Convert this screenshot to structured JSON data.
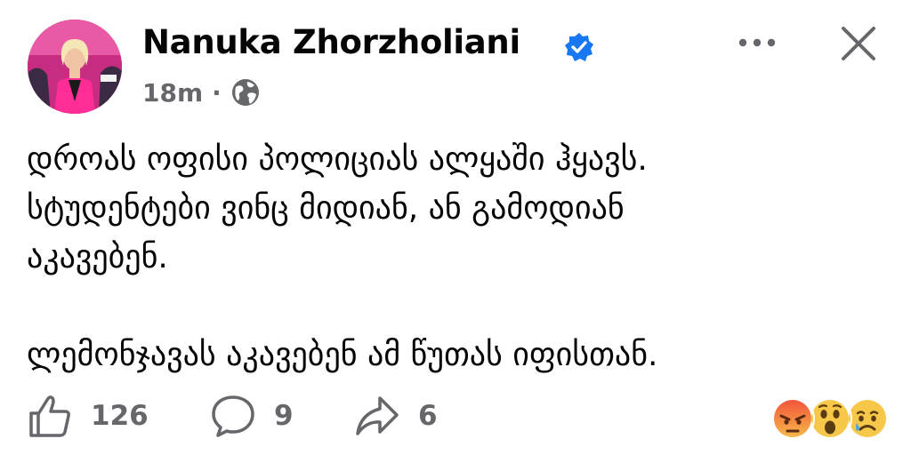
{
  "author": {
    "name": "Nanuka Zhorzholiani",
    "verified": true,
    "avatar_icon": "avatar-illustration"
  },
  "meta": {
    "time": "18m",
    "separator": "·",
    "privacy_icon": "globe-icon"
  },
  "header_actions": {
    "more_icon": "more-horizontal-icon",
    "close_icon": "close-icon"
  },
  "post": {
    "paragraph1_lines": [
      "დროას ოფისი პოლიციას ალყაში ჰყავს.",
      "სტუდენტები ვინც მიდიან, ან გამოდიან",
      "აკავებენ."
    ],
    "paragraph2": "ლემონჯავას აკავებენ ამ წუთას იფისთან."
  },
  "actions": {
    "likes": "126",
    "comments": "9",
    "shares": "6"
  },
  "reactions": [
    "angry",
    "wow",
    "sad"
  ],
  "colors": {
    "text": "#050505",
    "secondary": "#65676b",
    "verified": "#1877f2",
    "avatar_bg": "#c62c7f"
  }
}
